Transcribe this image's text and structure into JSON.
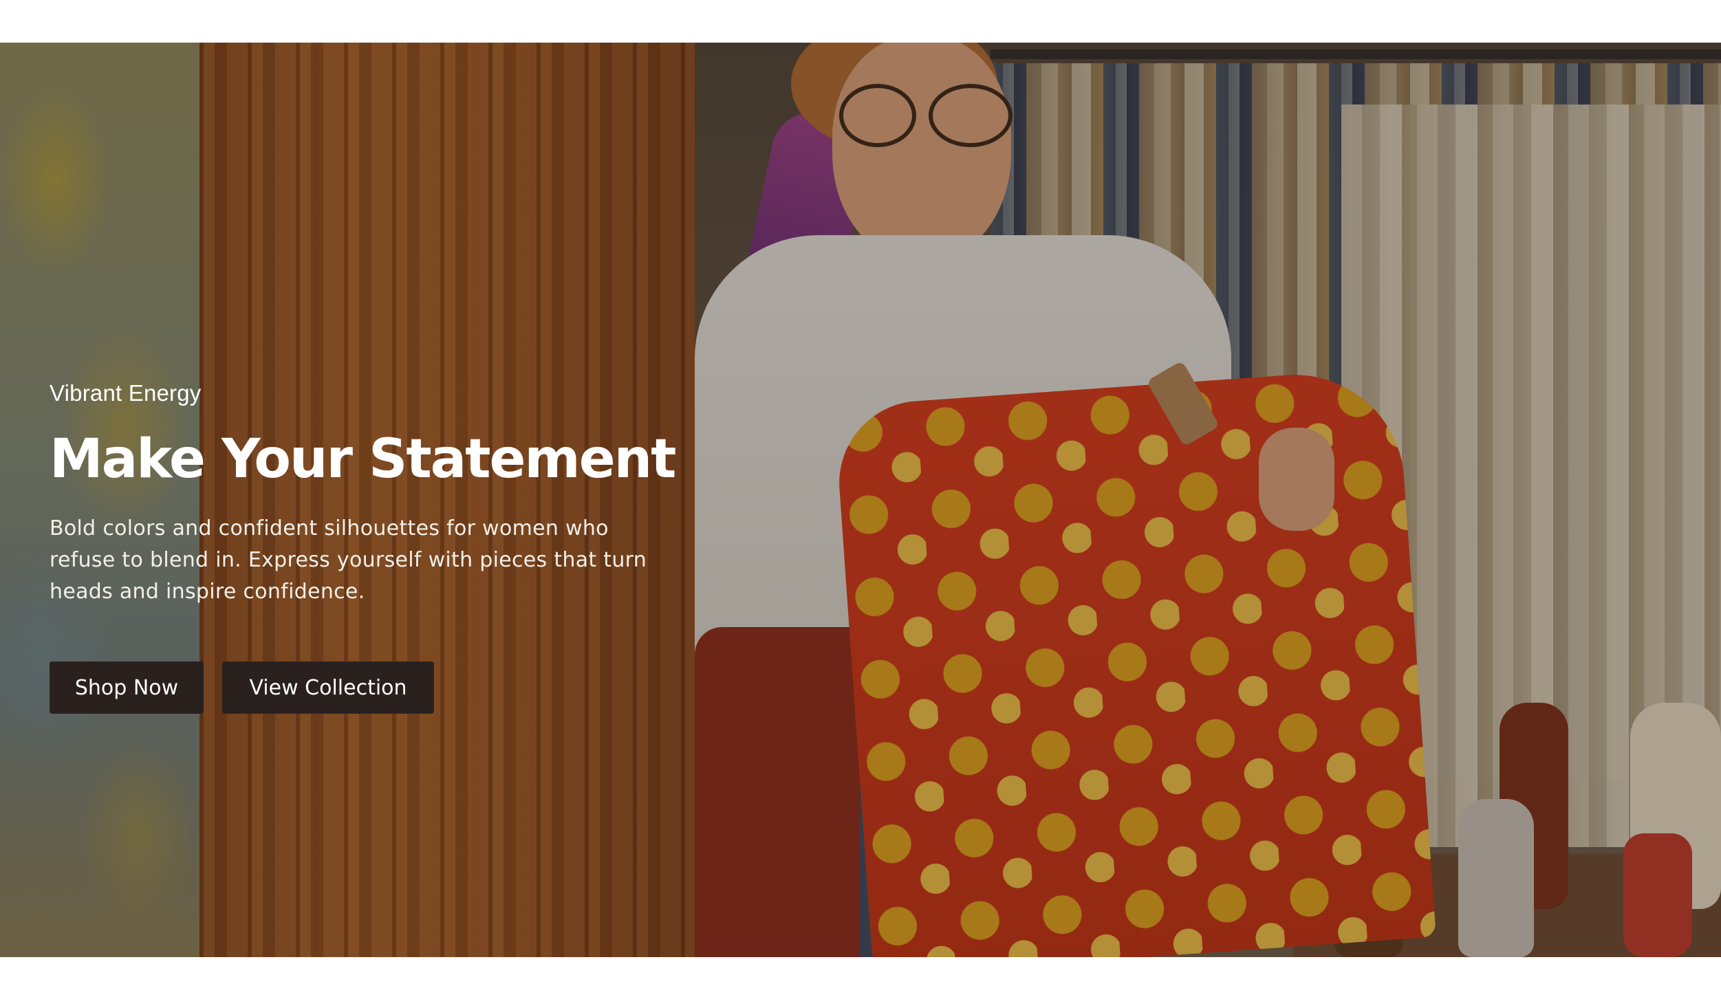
{
  "hero": {
    "eyebrow": "Vibrant Energy",
    "headline": "Make Your Statement",
    "description": "Bold colors and confident silhouettes for women who refuse to blend in. Express yourself with pieces that turn heads and inspire confidence.",
    "primary_button": "Shop Now",
    "secondary_button": "View Collection"
  },
  "colors": {
    "page_background": "#ffffff",
    "button_background": "#2a211f",
    "button_text": "#ffffff",
    "hero_text": "#ffffff"
  }
}
